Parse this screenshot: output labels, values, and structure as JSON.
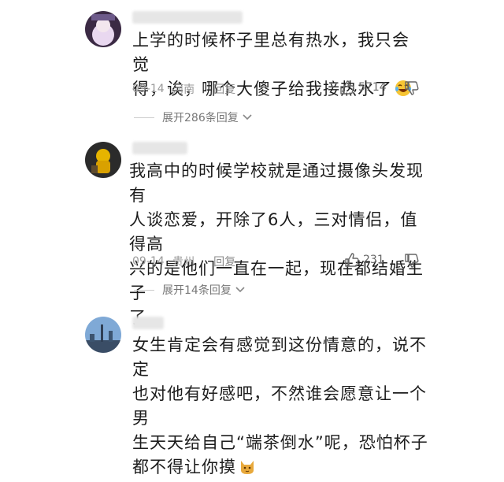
{
  "comments": [
    {
      "text_lines": [
        "上学的时候杯子里总有热水，我只会觉",
        "得，诶，哪个大傻子给我接热水了"
      ],
      "date": "09-14",
      "location": "河南",
      "reply_label": "回复",
      "like_count": "5714",
      "expand_label": "展开286条回复",
      "emoji": "laughing-crying-emoji"
    },
    {
      "text_lines": [
        "我高中的时候学校就是通过摄像头发现有",
        "人谈恋爱，开除了6人，三对情侣，值得高",
        "兴的是他们一直在一起，现在都结婚生子",
        "了"
      ],
      "date": "09-14",
      "location": "贵州",
      "reply_label": "回复",
      "like_count": "231",
      "expand_label": "展开14条回复"
    },
    {
      "text_lines": [
        "女生肯定会有感觉到这份情意的，说不定",
        "也对他有好感吧，不然谁会愿意让一个男",
        "生天天给自己“端茶倒水”呢，恐怕杯子",
        "都不得让你摸"
      ],
      "emoji": "cat-emoji"
    }
  ],
  "colors": {
    "meta": "#9a9a9a",
    "text": "#1c1c1c",
    "accent": "#666666"
  },
  "icons": {
    "like": "thumbs-up-icon",
    "dislike": "thumbs-down-icon",
    "expand": "chevron-down-icon"
  }
}
